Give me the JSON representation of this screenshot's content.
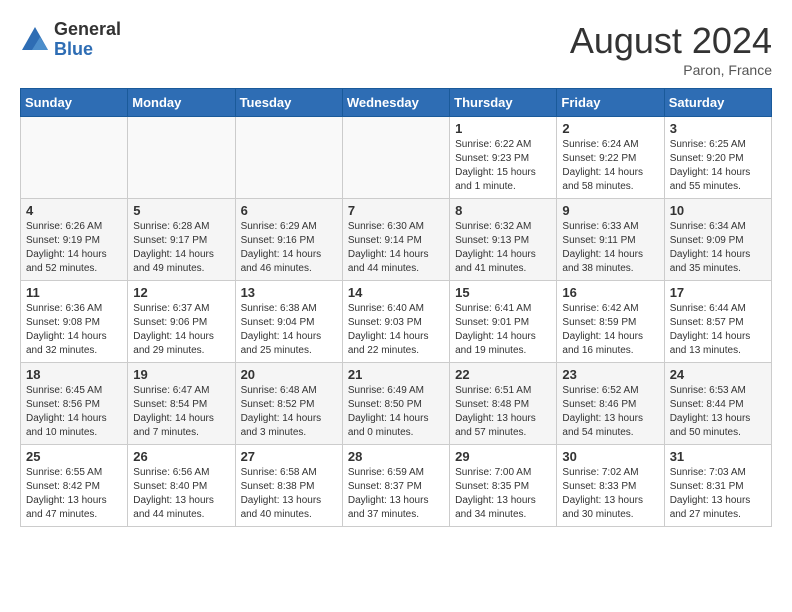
{
  "logo": {
    "general": "General",
    "blue": "Blue"
  },
  "title": "August 2024",
  "location": "Paron, France",
  "weekdays": [
    "Sunday",
    "Monday",
    "Tuesday",
    "Wednesday",
    "Thursday",
    "Friday",
    "Saturday"
  ],
  "weeks": [
    [
      {
        "day": "",
        "info": ""
      },
      {
        "day": "",
        "info": ""
      },
      {
        "day": "",
        "info": ""
      },
      {
        "day": "",
        "info": ""
      },
      {
        "day": "1",
        "info": "Sunrise: 6:22 AM\nSunset: 9:23 PM\nDaylight: 15 hours and 1 minute."
      },
      {
        "day": "2",
        "info": "Sunrise: 6:24 AM\nSunset: 9:22 PM\nDaylight: 14 hours and 58 minutes."
      },
      {
        "day": "3",
        "info": "Sunrise: 6:25 AM\nSunset: 9:20 PM\nDaylight: 14 hours and 55 minutes."
      }
    ],
    [
      {
        "day": "4",
        "info": "Sunrise: 6:26 AM\nSunset: 9:19 PM\nDaylight: 14 hours and 52 minutes."
      },
      {
        "day": "5",
        "info": "Sunrise: 6:28 AM\nSunset: 9:17 PM\nDaylight: 14 hours and 49 minutes."
      },
      {
        "day": "6",
        "info": "Sunrise: 6:29 AM\nSunset: 9:16 PM\nDaylight: 14 hours and 46 minutes."
      },
      {
        "day": "7",
        "info": "Sunrise: 6:30 AM\nSunset: 9:14 PM\nDaylight: 14 hours and 44 minutes."
      },
      {
        "day": "8",
        "info": "Sunrise: 6:32 AM\nSunset: 9:13 PM\nDaylight: 14 hours and 41 minutes."
      },
      {
        "day": "9",
        "info": "Sunrise: 6:33 AM\nSunset: 9:11 PM\nDaylight: 14 hours and 38 minutes."
      },
      {
        "day": "10",
        "info": "Sunrise: 6:34 AM\nSunset: 9:09 PM\nDaylight: 14 hours and 35 minutes."
      }
    ],
    [
      {
        "day": "11",
        "info": "Sunrise: 6:36 AM\nSunset: 9:08 PM\nDaylight: 14 hours and 32 minutes."
      },
      {
        "day": "12",
        "info": "Sunrise: 6:37 AM\nSunset: 9:06 PM\nDaylight: 14 hours and 29 minutes."
      },
      {
        "day": "13",
        "info": "Sunrise: 6:38 AM\nSunset: 9:04 PM\nDaylight: 14 hours and 25 minutes."
      },
      {
        "day": "14",
        "info": "Sunrise: 6:40 AM\nSunset: 9:03 PM\nDaylight: 14 hours and 22 minutes."
      },
      {
        "day": "15",
        "info": "Sunrise: 6:41 AM\nSunset: 9:01 PM\nDaylight: 14 hours and 19 minutes."
      },
      {
        "day": "16",
        "info": "Sunrise: 6:42 AM\nSunset: 8:59 PM\nDaylight: 14 hours and 16 minutes."
      },
      {
        "day": "17",
        "info": "Sunrise: 6:44 AM\nSunset: 8:57 PM\nDaylight: 14 hours and 13 minutes."
      }
    ],
    [
      {
        "day": "18",
        "info": "Sunrise: 6:45 AM\nSunset: 8:56 PM\nDaylight: 14 hours and 10 minutes."
      },
      {
        "day": "19",
        "info": "Sunrise: 6:47 AM\nSunset: 8:54 PM\nDaylight: 14 hours and 7 minutes."
      },
      {
        "day": "20",
        "info": "Sunrise: 6:48 AM\nSunset: 8:52 PM\nDaylight: 14 hours and 3 minutes."
      },
      {
        "day": "21",
        "info": "Sunrise: 6:49 AM\nSunset: 8:50 PM\nDaylight: 14 hours and 0 minutes."
      },
      {
        "day": "22",
        "info": "Sunrise: 6:51 AM\nSunset: 8:48 PM\nDaylight: 13 hours and 57 minutes."
      },
      {
        "day": "23",
        "info": "Sunrise: 6:52 AM\nSunset: 8:46 PM\nDaylight: 13 hours and 54 minutes."
      },
      {
        "day": "24",
        "info": "Sunrise: 6:53 AM\nSunset: 8:44 PM\nDaylight: 13 hours and 50 minutes."
      }
    ],
    [
      {
        "day": "25",
        "info": "Sunrise: 6:55 AM\nSunset: 8:42 PM\nDaylight: 13 hours and 47 minutes."
      },
      {
        "day": "26",
        "info": "Sunrise: 6:56 AM\nSunset: 8:40 PM\nDaylight: 13 hours and 44 minutes."
      },
      {
        "day": "27",
        "info": "Sunrise: 6:58 AM\nSunset: 8:38 PM\nDaylight: 13 hours and 40 minutes."
      },
      {
        "day": "28",
        "info": "Sunrise: 6:59 AM\nSunset: 8:37 PM\nDaylight: 13 hours and 37 minutes."
      },
      {
        "day": "29",
        "info": "Sunrise: 7:00 AM\nSunset: 8:35 PM\nDaylight: 13 hours and 34 minutes."
      },
      {
        "day": "30",
        "info": "Sunrise: 7:02 AM\nSunset: 8:33 PM\nDaylight: 13 hours and 30 minutes."
      },
      {
        "day": "31",
        "info": "Sunrise: 7:03 AM\nSunset: 8:31 PM\nDaylight: 13 hours and 27 minutes."
      }
    ]
  ]
}
